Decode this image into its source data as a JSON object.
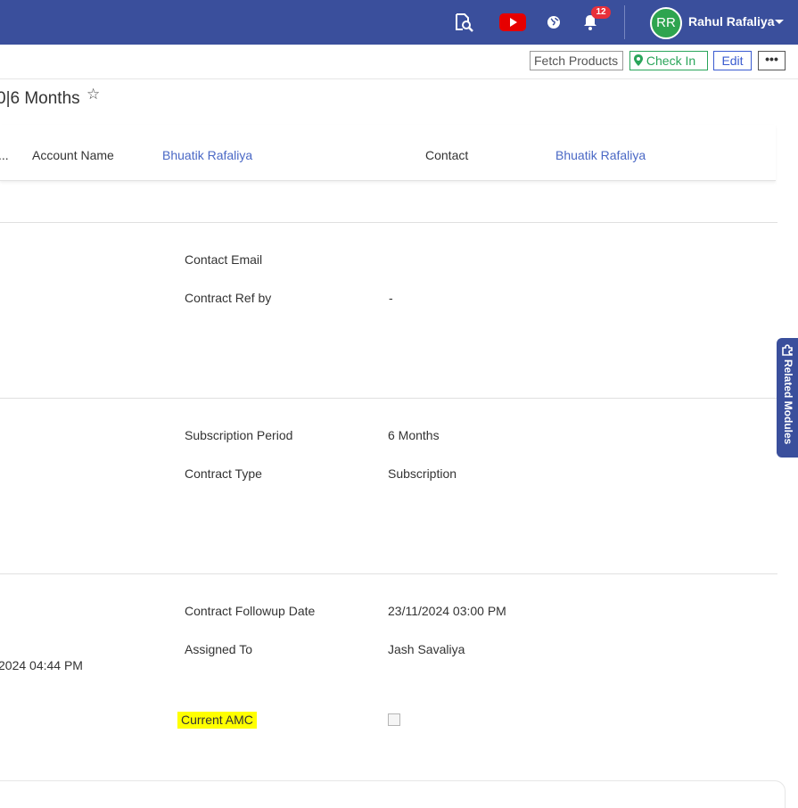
{
  "topbar": {
    "icons": [
      "search-document-icon",
      "youtube-icon",
      "globe-icon",
      "bell-icon"
    ],
    "notification_count": "12",
    "user_initials": "RR",
    "user_name": "Rahul Rafaliya",
    "colors": {
      "bar": "#3a4f9c",
      "avatar": "#2ea44f",
      "youtube": "#e60000",
      "badge": "#e8303a"
    }
  },
  "actions": {
    "fetch_products": "Fetch Products",
    "check_in": "Check In",
    "edit": "Edit",
    "more": "•••"
  },
  "record": {
    "title": "0|6 Months",
    "star_icon": "☆"
  },
  "summary": {
    "truncated": "...",
    "account_name_label": "Account Name",
    "account_name_value": "Bhuatik Rafaliya",
    "contact_label": "Contact",
    "contact_value": "Bhuatik Rafaliya"
  },
  "section1": {
    "contact_email_label": "Contact Email",
    "contract_ref_label": "Contract Ref by",
    "contract_ref_value": "-"
  },
  "section2": {
    "subscription_period_label": "Subscription Period",
    "subscription_period_value": "6 Months",
    "contract_type_label": "Contract Type",
    "contract_type_value": "Subscription"
  },
  "section3": {
    "followup_label": "Contract Followup Date",
    "followup_value": "23/11/2024 03:00 PM",
    "assigned_label": "Assigned To",
    "assigned_value": "Jash Savaliya",
    "left_date_partial": "2024 04:44 PM",
    "current_amc_label": "Current AMC",
    "current_amc_checked": false
  },
  "related_modules": {
    "label": "Related Modules",
    "icon": "puzzle-icon"
  }
}
